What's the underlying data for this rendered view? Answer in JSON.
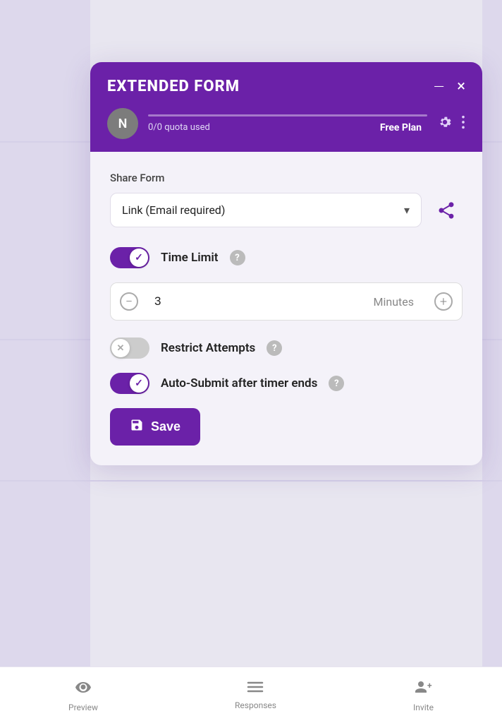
{
  "app": {
    "title": "EXTENDED FORM",
    "minimize_label": "—",
    "close_label": "×"
  },
  "header": {
    "avatar_letter": "N",
    "quota_text": "0/0 quota used",
    "plan_text": "Free Plan"
  },
  "share": {
    "section_label": "Share Form",
    "dropdown_value": "Link (Email required)"
  },
  "time_limit": {
    "label": "Time Limit",
    "enabled": true,
    "value": "3",
    "unit": "Minutes"
  },
  "restrict_attempts": {
    "label": "Restrict Attempts",
    "enabled": false
  },
  "auto_submit": {
    "label": "Auto-Submit after timer ends",
    "enabled": true
  },
  "save_button": {
    "label": "Save"
  },
  "nav": {
    "preview_label": "Preview",
    "responses_label": "Responses",
    "invite_label": "Invite"
  }
}
